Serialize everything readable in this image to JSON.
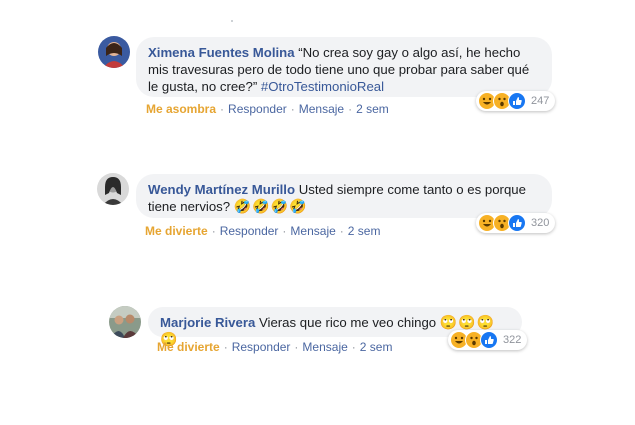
{
  "comments": [
    {
      "author": "Ximena Fuentes Molina",
      "text": "“No crea soy gay o algo así, he hecho mis travesuras pero de todo tiene uno que probar para saber qué le gusta, no cree?”",
      "hashtag": "#OtroTestimonioReal",
      "reaction_label": "Me asombra",
      "reply_label": "Responder",
      "message_label": "Mensaje",
      "time": "2 sem",
      "reaction_count": "247",
      "reaction_icons": [
        "haha-icon",
        "wow-icon",
        "like-icon"
      ]
    },
    {
      "author": "Wendy Martínez Murillo",
      "text": "Usted siempre come tanto o es porque tiene nervios?",
      "emojis": "🤣🤣🤣🤣",
      "reaction_label": "Me divierte",
      "reply_label": "Responder",
      "message_label": "Mensaje",
      "time": "2 sem",
      "reaction_count": "320",
      "reaction_icons": [
        "haha-icon",
        "wow-icon",
        "like-icon"
      ]
    },
    {
      "author": "Marjorie Rivera",
      "text": "Vieras que rico me veo chingo",
      "emojis": "🙄🙄🙄🙄",
      "reaction_label": "Me divierte",
      "reply_label": "Responder",
      "message_label": "Mensaje",
      "time": "2 sem",
      "reaction_count": "322",
      "reaction_icons": [
        "haha-icon",
        "wow-icon",
        "like-icon"
      ]
    }
  ],
  "colors": {
    "author": "#385898",
    "bubble": "#f2f3f5",
    "reaction_active": "#e6a532",
    "meta": "#90949c"
  }
}
